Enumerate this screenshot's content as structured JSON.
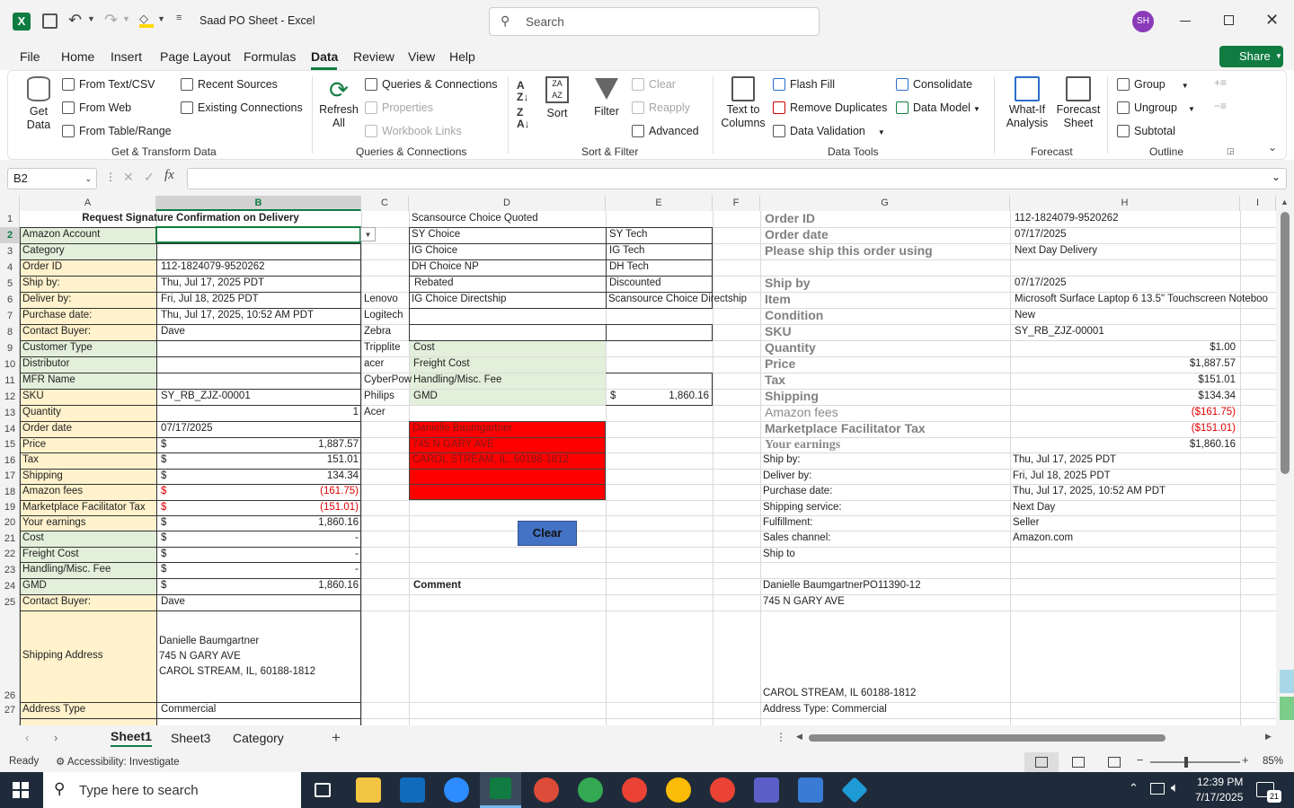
{
  "window": {
    "title": "Saad PO Sheet  -  Excel",
    "search_placeholder": "Search",
    "user_initials": "SH"
  },
  "menu_tabs": [
    "File",
    "Home",
    "Insert",
    "Page Layout",
    "Formulas",
    "Data",
    "Review",
    "View",
    "Help"
  ],
  "active_tab": "Data",
  "share_label": "Share",
  "ribbon": {
    "get_data": "Get Data",
    "from_text_csv": "From Text/CSV",
    "from_web": "From Web",
    "from_table_range": "From Table/Range",
    "recent_sources": "Recent Sources",
    "existing_connections": "Existing Connections",
    "group_get_transform": "Get & Transform Data",
    "refresh_all": "Refresh All",
    "queries_connections": "Queries & Connections",
    "properties": "Properties",
    "workbook_links": "Workbook Links",
    "group_queries": "Queries & Connections",
    "sort": "Sort",
    "filter": "Filter",
    "clear": "Clear",
    "reapply": "Reapply",
    "advanced": "Advanced",
    "group_sort_filter": "Sort & Filter",
    "text_to_columns": "Text to Columns",
    "flash_fill": "Flash Fill",
    "remove_duplicates": "Remove Duplicates",
    "data_validation": "Data Validation",
    "consolidate": "Consolidate",
    "data_model": "Data Model",
    "group_data_tools": "Data Tools",
    "what_if": "What-If Analysis",
    "forecast_sheet": "Forecast Sheet",
    "group_forecast": "Forecast",
    "group": "Group",
    "ungroup": "Ungroup",
    "subtotal": "Subtotal",
    "group_outline": "Outline"
  },
  "name_box": "B2",
  "formula": "",
  "columns": [
    "A",
    "B",
    "C",
    "D",
    "E",
    "F",
    "G",
    "H",
    "I"
  ],
  "cells": {
    "B1": "Request Signature Confirmation on Delivery",
    "A2": "Amazon Account",
    "A3": "Category",
    "A4": "Order ID",
    "B4": "112-1824079-9520262",
    "A5": "Ship by:",
    "B5": "Thu, Jul 17, 2025 PDT",
    "A6": "Deliver by:",
    "B6": "Fri, Jul 18, 2025 PDT",
    "A7": "Purchase date:",
    "B7": "Thu, Jul 17, 2025, 10:52 AM PDT",
    "A8": "Contact Buyer:",
    "B8": "Dave",
    "A9": "Customer Type",
    "A10": "Distributor",
    "A11": "MFR Name",
    "A12": "SKU",
    "B12": "SY_RB_ZJZ-00001",
    "A13": "Quantity",
    "B13": "1",
    "A14": "Order date",
    "B14": "07/17/2025",
    "A15": "Price",
    "B15": "1,887.57",
    "A16": "Tax",
    "B16": "151.01",
    "A17": "Shipping",
    "B17": "134.34",
    "A18": "Amazon fees",
    "B18": "(161.75)",
    "A19": "Marketplace Facilitator Tax",
    "B19": "(151.01)",
    "A20": "Your earnings",
    "B20": "1,860.16",
    "A21": "Cost",
    "B21": "-",
    "A22": "Freight Cost",
    "B22": "-",
    "A23": "Handling/Misc. Fee",
    "B23": "-",
    "A24": "GMD",
    "B24": "1,860.16",
    "A25": "Contact Buyer:",
    "B25": "Dave",
    "A26": "Shipping Address",
    "B26a": "Danielle Baumgartner",
    "B26b": "745 N GARY AVE",
    "B26c": "CAROL STREAM, IL, 60188-1812",
    "A27": "Address Type",
    "B27": "Commercial",
    "dollar": "$",
    "C6": "Lenovo",
    "C7": "Logitech",
    "C8": "Zebra",
    "C9": "Tripplite",
    "C10": "acer",
    "C11": "CyberPow",
    "C12": "Philips",
    "C13": "Acer",
    "D1": "Scansource Choice Quoted",
    "D2": "SY Choice",
    "E2": "SY Tech",
    "D3": "IG Choice",
    "E3": "IG Tech",
    "D4": "DH Choice NP",
    "E4": "DH Tech",
    "D5": "Rebated",
    "E5": "Discounted",
    "D6": "IG Choice Directship",
    "E6": "Scansource Choice Directship",
    "D9": "Cost",
    "D10": "Freight Cost",
    "D11": "Handling/Misc. Fee",
    "D12": "GMD",
    "E12": "1,860.16",
    "D14": "Danielle Baumgartner",
    "D15": "745 N GARY AVE",
    "D16": "CAROL STREAM, IL, 60188-1812",
    "clear_button": "Clear",
    "D24": "Comment",
    "G1": "Order ID",
    "H1": "112-1824079-9520262",
    "G2": "Order date",
    "H2": "07/17/2025",
    "G3": "Please ship this order using",
    "H3": "Next Day Delivery",
    "G5": "Ship by",
    "H5": "07/17/2025",
    "G6": "Item",
    "H6": "Microsoft Surface Laptop 6 13.5\" Touchscreen Noteboo",
    "G7": "Condition",
    "H7": "New",
    "G8": "SKU",
    "H8": "SY_RB_ZJZ-00001",
    "G9": "Quantity",
    "H9": "$1.00",
    "G10": "Price",
    "H10": "$1,887.57",
    "G11": "Tax",
    "H11": "$151.01",
    "G12": "Shipping",
    "H12": "$134.34",
    "G13": "Amazon fees",
    "H13": "($161.75)",
    "G14": "Marketplace Facilitator Tax",
    "H14": "($151.01)",
    "G15": "Your earnings",
    "H15": "$1,860.16",
    "G16": "Ship by:",
    "H16": "Thu, Jul 17, 2025 PDT",
    "G17": "Deliver by:",
    "H17": "Fri, Jul 18, 2025 PDT",
    "G18": "Purchase date:",
    "H18": "Thu, Jul 17, 2025, 10:52 AM PDT",
    "G19": "Shipping service:",
    "H19": "Next Day",
    "G20": "Fulfillment:",
    "H20": "Seller",
    "G21": "Sales channel:",
    "H21": "Amazon.com",
    "G22": "Ship to",
    "G24": "Danielle BaumgartnerPO11390-12",
    "G25": "745 N GARY AVE",
    "G26": "CAROL STREAM, IL 60188-1812",
    "G27": "Address Type:  Commercial"
  },
  "sheet_tabs": [
    "Sheet1",
    "Sheet3",
    "Category"
  ],
  "active_sheet": "Sheet1",
  "status": {
    "ready": "Ready",
    "accessibility": "Accessibility: Investigate",
    "zoom": "85%"
  },
  "taskbar": {
    "search_placeholder": "Type here to search",
    "time": "12:39 PM",
    "date": "7/17/2025",
    "notifications": "21"
  },
  "colors": {
    "excel_green": "#107c41",
    "label_yellow": "#fff2cc",
    "label_green": "#e2efda",
    "red_fill": "#ff0000",
    "button_blue": "#4472c4"
  }
}
